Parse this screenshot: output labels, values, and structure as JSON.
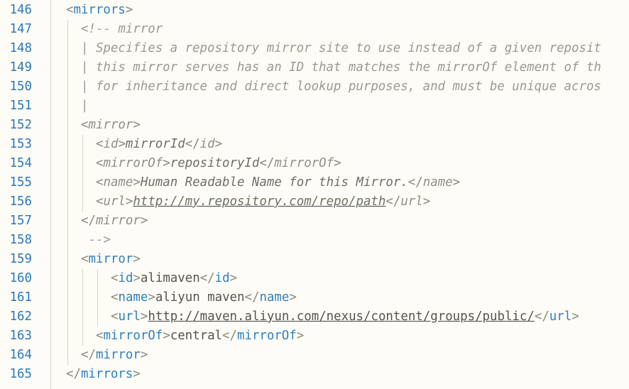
{
  "editor": {
    "lines": [
      {
        "n": "146",
        "indent": 0,
        "tokens": [
          [
            "p",
            "<"
          ],
          [
            "t",
            "mirrors"
          ],
          [
            "p",
            ">"
          ]
        ]
      },
      {
        "n": "147",
        "indent": 1,
        "tokens": [
          [
            "c",
            "<!-- mirror"
          ]
        ]
      },
      {
        "n": "148",
        "indent": 1,
        "tokens": [
          [
            "c",
            "| Specifies a repository mirror site to use instead of a given reposit"
          ]
        ]
      },
      {
        "n": "149",
        "indent": 1,
        "tokens": [
          [
            "c",
            "| this mirror serves has an ID that matches the mirrorOf element of th"
          ]
        ]
      },
      {
        "n": "150",
        "indent": 1,
        "tokens": [
          [
            "c",
            "| for inheritance and direct lookup purposes, and must be unique acros"
          ]
        ]
      },
      {
        "n": "151",
        "indent": 1,
        "tokens": [
          [
            "c",
            "|"
          ]
        ]
      },
      {
        "n": "152",
        "indent": 1,
        "tokens": [
          [
            "p",
            "<"
          ],
          [
            "ti",
            "mirror"
          ],
          [
            "p",
            ">"
          ]
        ]
      },
      {
        "n": "153",
        "indent": 2,
        "tokens": [
          [
            "p",
            "<"
          ],
          [
            "ti",
            "id"
          ],
          [
            "p",
            ">"
          ],
          [
            "xi",
            "mirrorId"
          ],
          [
            "p",
            "</"
          ],
          [
            "ti",
            "id"
          ],
          [
            "p",
            ">"
          ]
        ]
      },
      {
        "n": "154",
        "indent": 2,
        "tokens": [
          [
            "p",
            "<"
          ],
          [
            "ti",
            "mirrorOf"
          ],
          [
            "p",
            ">"
          ],
          [
            "xi",
            "repositoryId"
          ],
          [
            "p",
            "</"
          ],
          [
            "ti",
            "mirrorOf"
          ],
          [
            "p",
            ">"
          ]
        ]
      },
      {
        "n": "155",
        "indent": 2,
        "tokens": [
          [
            "p",
            "<"
          ],
          [
            "ti",
            "name"
          ],
          [
            "p",
            ">"
          ],
          [
            "xi",
            "Human Readable Name for this Mirror."
          ],
          [
            "p",
            "</"
          ],
          [
            "ti",
            "name"
          ],
          [
            "p",
            ">"
          ]
        ]
      },
      {
        "n": "156",
        "indent": 2,
        "tokens": [
          [
            "p",
            "<"
          ],
          [
            "ti",
            "url"
          ],
          [
            "p",
            ">"
          ],
          [
            "ui",
            "http://my.repository.com/repo/path"
          ],
          [
            "p",
            "</"
          ],
          [
            "ti",
            "url"
          ],
          [
            "p",
            ">"
          ]
        ]
      },
      {
        "n": "157",
        "indent": 1,
        "tokens": [
          [
            "p",
            "</"
          ],
          [
            "ti",
            "mirror"
          ],
          [
            "p",
            ">"
          ]
        ]
      },
      {
        "n": "158",
        "indent": 1,
        "tokens": [
          [
            "c",
            " -->"
          ]
        ]
      },
      {
        "n": "159",
        "indent": 1,
        "tokens": [
          [
            "p",
            "<"
          ],
          [
            "t",
            "mirror"
          ],
          [
            "p",
            ">"
          ]
        ]
      },
      {
        "n": "160",
        "indent": 3,
        "tokens": [
          [
            "p",
            "<"
          ],
          [
            "t",
            "id"
          ],
          [
            "p",
            ">"
          ],
          [
            "x",
            "alimaven"
          ],
          [
            "p",
            "</"
          ],
          [
            "t",
            "id"
          ],
          [
            "p",
            ">"
          ]
        ]
      },
      {
        "n": "161",
        "indent": 3,
        "tokens": [
          [
            "p",
            "<"
          ],
          [
            "t",
            "name"
          ],
          [
            "p",
            ">"
          ],
          [
            "x",
            "aliyun maven"
          ],
          [
            "p",
            "</"
          ],
          [
            "t",
            "name"
          ],
          [
            "p",
            ">"
          ]
        ]
      },
      {
        "n": "162",
        "indent": 3,
        "tokens": [
          [
            "p",
            "<"
          ],
          [
            "t",
            "url"
          ],
          [
            "p",
            ">"
          ],
          [
            "u",
            "http://maven.aliyun.com/nexus/content/groups/public/"
          ],
          [
            "p",
            "</"
          ],
          [
            "t",
            "url"
          ],
          [
            "p",
            ">"
          ]
        ]
      },
      {
        "n": "163",
        "indent": 2,
        "tokens": [
          [
            "p",
            "<"
          ],
          [
            "t",
            "mirrorOf"
          ],
          [
            "p",
            ">"
          ],
          [
            "x",
            "central"
          ],
          [
            "p",
            "</"
          ],
          [
            "t",
            "mirrorOf"
          ],
          [
            "p",
            ">"
          ]
        ]
      },
      {
        "n": "164",
        "indent": 1,
        "tokens": [
          [
            "p",
            "</"
          ],
          [
            "t",
            "mirror"
          ],
          [
            "p",
            ">"
          ]
        ]
      },
      {
        "n": "165",
        "indent": 0,
        "tokens": [
          [
            "p",
            "</"
          ],
          [
            "t",
            "mirrors"
          ],
          [
            "p",
            ">"
          ]
        ]
      }
    ]
  }
}
